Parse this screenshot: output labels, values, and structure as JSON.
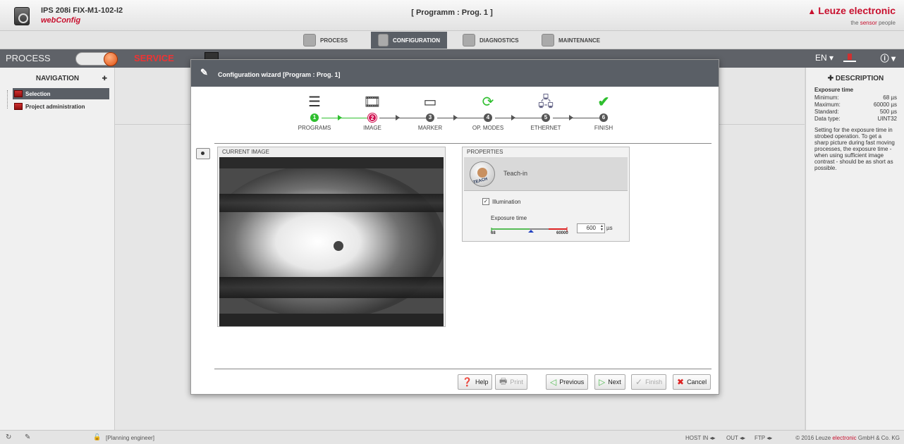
{
  "header": {
    "device_name": "IPS 208i FIX-M1-102-I2",
    "app_name": "webConfig",
    "program_title": "[ Programm : Prog. 1 ]",
    "logo": "Leuze electronic",
    "tagline_prefix": "the ",
    "tagline_highlight": "sensor",
    "tagline_suffix": " people"
  },
  "tabs": [
    {
      "label": "PROCESS",
      "icon": "process-gear-icon"
    },
    {
      "label": "CONFIGURATION",
      "icon": "configuration-gear-icon",
      "active": true
    },
    {
      "label": "DIAGNOSTICS",
      "icon": "stethoscope-icon"
    },
    {
      "label": "MAINTENANCE",
      "icon": "wrench-icon"
    }
  ],
  "modebar": {
    "process_label": "PROCESS",
    "service_label": "SERVICE",
    "language": "EN",
    "info_symbol": "ⓘ"
  },
  "navigation": {
    "title": "NAVIGATION",
    "items": [
      {
        "label": "Selection",
        "selected": true
      },
      {
        "label": "Project administration"
      }
    ]
  },
  "description": {
    "title": "DESCRIPTION",
    "param_title": "Exposure time",
    "rows": [
      {
        "key": "Minimum:",
        "value": "68 µs"
      },
      {
        "key": "Maximum:",
        "value": "60000 µs"
      },
      {
        "key": "Standard:",
        "value": "500 µs"
      },
      {
        "key": "Data type:",
        "value": "UINT32"
      }
    ],
    "text": "Setting for the exposure time in strobed operation. To get a sharp picture during fast moving processes, the exposure time - when using sufficient image contrast - should be as short as possible."
  },
  "dialog": {
    "title": "Configuration wizard [Program : Prog. 1]",
    "steps": [
      {
        "num": "1",
        "label": "PROGRAMS",
        "icon": "list-icon",
        "state": "done"
      },
      {
        "num": "2",
        "label": "IMAGE",
        "icon": "film-icon",
        "state": "current"
      },
      {
        "num": "3",
        "label": "MARKER",
        "icon": "marker-icon",
        "state": "todo"
      },
      {
        "num": "4",
        "label": "OP. MODES",
        "icon": "cycle-icon",
        "state": "todo"
      },
      {
        "num": "5",
        "label": "ETHERNET",
        "icon": "network-icon",
        "state": "todo"
      },
      {
        "num": "6",
        "label": "FINISH",
        "icon": "checkmark-icon",
        "state": "todo"
      }
    ],
    "current_image_label": "CURRENT IMAGE",
    "properties_label": "PROPERTIES",
    "teach_label": "Teach-in",
    "teach_badge": "TEACH",
    "illumination_label": "Illumination",
    "illumination_checked": true,
    "exposure_label": "Exposure time",
    "exposure_value": "600",
    "exposure_unit": "µs",
    "slider_min": "68",
    "slider_max": "60000",
    "buttons": {
      "help": "Help",
      "print": "Print",
      "previous": "Previous",
      "next": "Next",
      "finish": "Finish",
      "cancel": "Cancel"
    }
  },
  "statusbar": {
    "role": "[Planning engineer]",
    "host_in": "HOST IN",
    "out": "OUT",
    "ftp": "FTP",
    "copyright_prefix": "© 2016 Leuze ",
    "copyright_highlight": "electronic",
    "copyright_suffix": " GmbH & Co. KG"
  },
  "colors": {
    "brand_red": "#c8102e",
    "step_done": "#2fbf2f",
    "step_current": "#d01050",
    "header_dark": "#5a5f66"
  }
}
